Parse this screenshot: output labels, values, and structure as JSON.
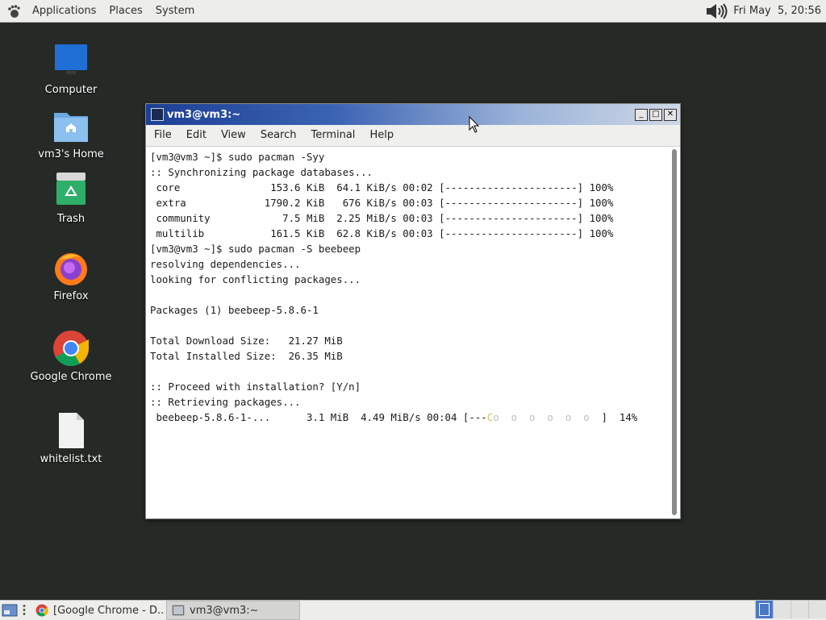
{
  "top_panel": {
    "menus": [
      "Applications",
      "Places",
      "System"
    ],
    "clock": "Fri May  5, 20:56"
  },
  "desktop": {
    "icons": [
      {
        "label": "Computer",
        "icon": "monitor-icon"
      },
      {
        "label": "vm3's Home",
        "icon": "home-folder-icon"
      },
      {
        "label": "Trash",
        "icon": "trash-icon"
      },
      {
        "label": "Firefox",
        "icon": "firefox-icon"
      },
      {
        "label": "Google Chrome",
        "icon": "chrome-icon"
      },
      {
        "label": "whitelist.txt",
        "icon": "text-file-icon"
      }
    ]
  },
  "terminal": {
    "title": "vm3@vm3:~",
    "menu": [
      "File",
      "Edit",
      "View",
      "Search",
      "Terminal",
      "Help"
    ],
    "lines": [
      "[vm3@vm3 ~]$ sudo pacman -Syy",
      ":: Synchronizing package databases...",
      " core               153.6 KiB  64.1 KiB/s 00:02 [----------------------] 100%",
      " extra             1790.2 KiB   676 KiB/s 00:03 [----------------------] 100%",
      " community            7.5 MiB  2.25 MiB/s 00:03 [----------------------] 100%",
      " multilib           161.5 KiB  62.8 KiB/s 00:03 [----------------------] 100%",
      "[vm3@vm3 ~]$ sudo pacman -S beebeep",
      "resolving dependencies...",
      "looking for conflicting packages...",
      "",
      "Packages (1) beebeep-5.8.6-1",
      "",
      "Total Download Size:   21.27 MiB",
      "Total Installed Size:  26.35 MiB",
      "",
      ":: Proceed with installation? [Y/n]",
      ":: Retrieving packages..."
    ],
    "download_line": {
      "prefix": " beebeep-5.8.6-1-...      3.1 MiB  4.49 MiB/s 00:04 [---",
      "cursor": "C",
      "dots": "o  o  o  o  o  o ",
      "suffix": " ]  14%"
    }
  },
  "taskbar": {
    "tasks": [
      {
        "label": "[Google Chrome - D...",
        "icon": "chrome-icon",
        "active": false
      },
      {
        "label": "vm3@vm3:~",
        "icon": "terminal-icon",
        "active": true
      }
    ],
    "workspace_count": 4,
    "current_workspace": 1
  }
}
